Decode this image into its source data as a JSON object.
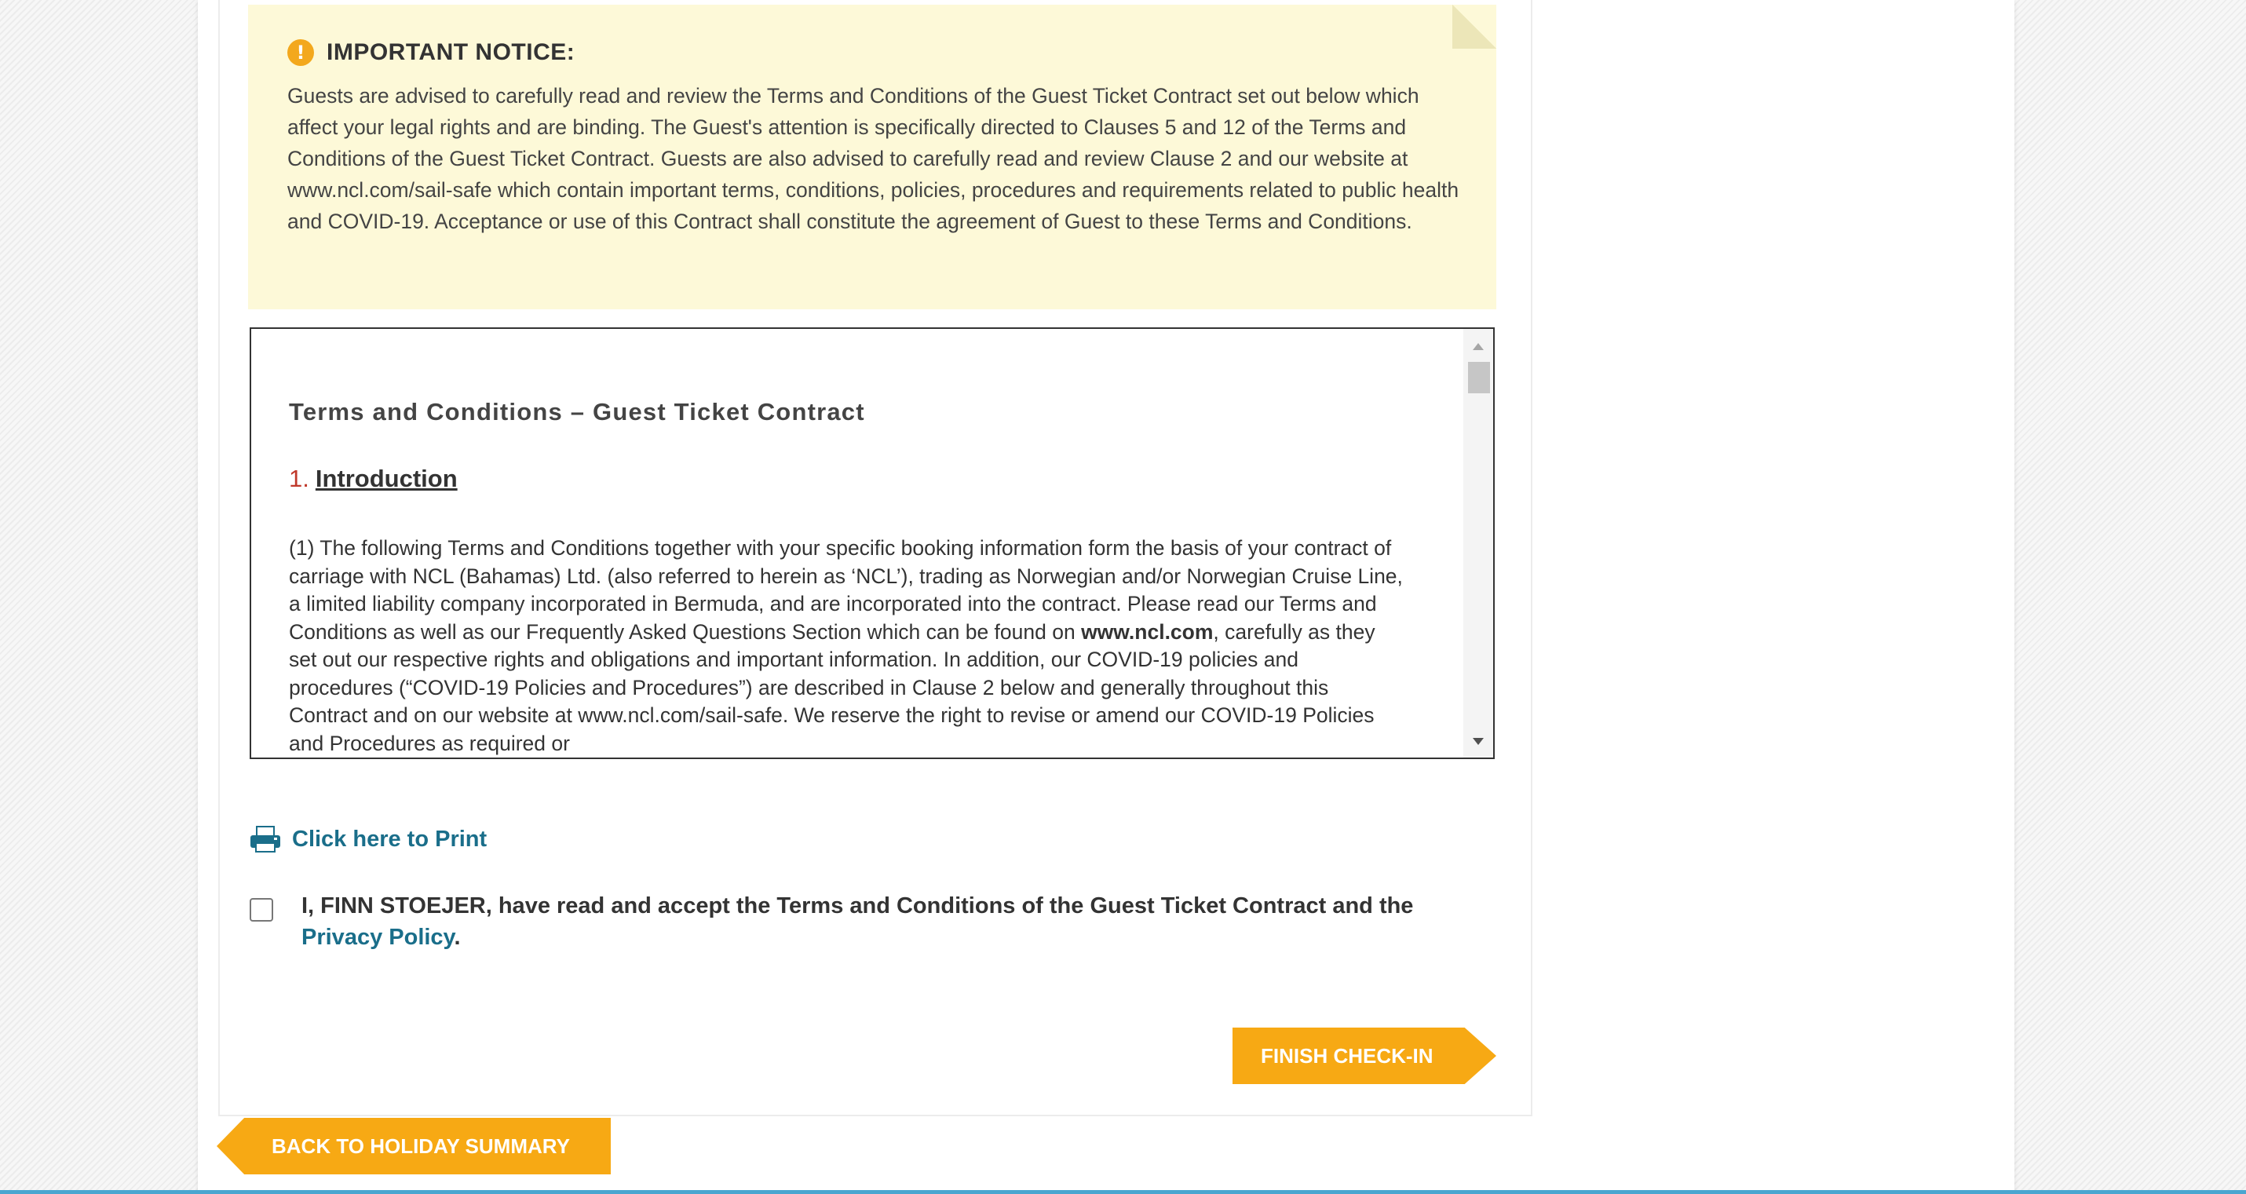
{
  "notice": {
    "title": "IMPORTANT NOTICE:",
    "body": "Guests are advised to carefully read and review the Terms and Conditions of the Guest Ticket Contract set out below which affect your legal rights and are binding. The Guest's attention is specifically directed to Clauses 5 and 12 of the Terms and Conditions of the Guest Ticket Contract. Guests are also advised to carefully read and review Clause 2 and our website at www.ncl.com/sail-safe which contain important terms, conditions, policies, procedures and requirements related to public health and COVID-19. Acceptance or use of this Contract shall constitute the agreement of Guest to these Terms and Conditions."
  },
  "terms": {
    "title": "Terms and Conditions – Guest Ticket Contract",
    "section_number": "1.",
    "section_name": "Introduction",
    "paragraph_part1": "(1) The following Terms and Conditions together with your specific booking information form the basis of your contract of carriage with NCL (Bahamas) Ltd. (also referred to herein as ‘NCL’), trading as Norwegian and/or Norwegian Cruise Line, a limited liability company incorporated in Bermuda, and are incorporated into the contract. Please read our Terms and Conditions as well as our Frequently Asked Questions Section which can be found on ",
    "paragraph_link": "www.ncl.com",
    "paragraph_part2": ", carefully as they set out our respective rights and obligations and important information. In addition, our COVID-19 policies and procedures (“COVID-19 Policies and Procedures”) are described in Clause 2 below and generally throughout this Contract and on our website at www.ncl.com/sail-safe. We reserve the right to revise or amend our COVID-19 Policies and Procedures as required or"
  },
  "print": {
    "label": "Click here to Print"
  },
  "acceptance": {
    "text": "I, FINN STOEJER, have read and accept the Terms and Conditions of the Guest Ticket Contract and the ",
    "privacy_link": "Privacy Policy",
    "suffix": ".",
    "checked": false
  },
  "buttons": {
    "finish": "FINISH CHECK-IN",
    "back": "BACK TO HOLIDAY SUMMARY"
  },
  "colors": {
    "accent": "#f7a914",
    "link": "#1a6e8a",
    "notice_bg": "#fdf9d8"
  }
}
